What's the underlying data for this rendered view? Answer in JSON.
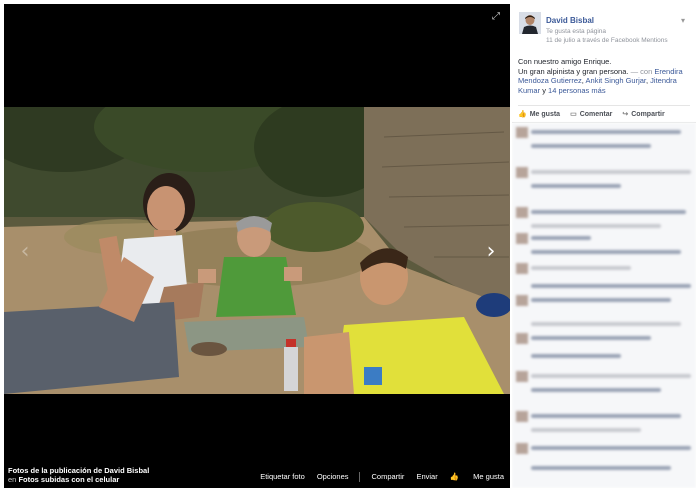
{
  "viewer": {
    "expand_icon": "expand-icon",
    "prev_icon": "chevron-left-icon",
    "next_icon": "chevron-right-icon"
  },
  "caption": {
    "title": "Fotos de la publicación de David Bisbal",
    "prefix": "en",
    "album": "Fotos subidas con el celular"
  },
  "photo_actions": {
    "tag": "Etiquetar foto",
    "options": "Opciones",
    "share": "Compartir",
    "send": "Enviar",
    "like": "Me gusta"
  },
  "post": {
    "page_name": "David Bisbal",
    "liked_status": "Te gusta esta página",
    "meta": "11 de julio a través de Facebook Mentions",
    "text_line1": "Con nuestro amigo Enrique.",
    "text_line2": "Un gran alpinista y gran persona.",
    "with_prefix": "— con",
    "tags": [
      "Erendira Mendoza Gutierrez",
      "Ankit Singh Gurjar",
      "Jitendra Kumar"
    ],
    "and_word": "y",
    "more": "14 personas más"
  },
  "sidebar_actions": {
    "like": "Me gusta",
    "comment": "Comentar",
    "share": "Compartir"
  },
  "colors": {
    "link": "#3b5998",
    "stage_bg": "#000000",
    "secondary": "#90949c"
  }
}
